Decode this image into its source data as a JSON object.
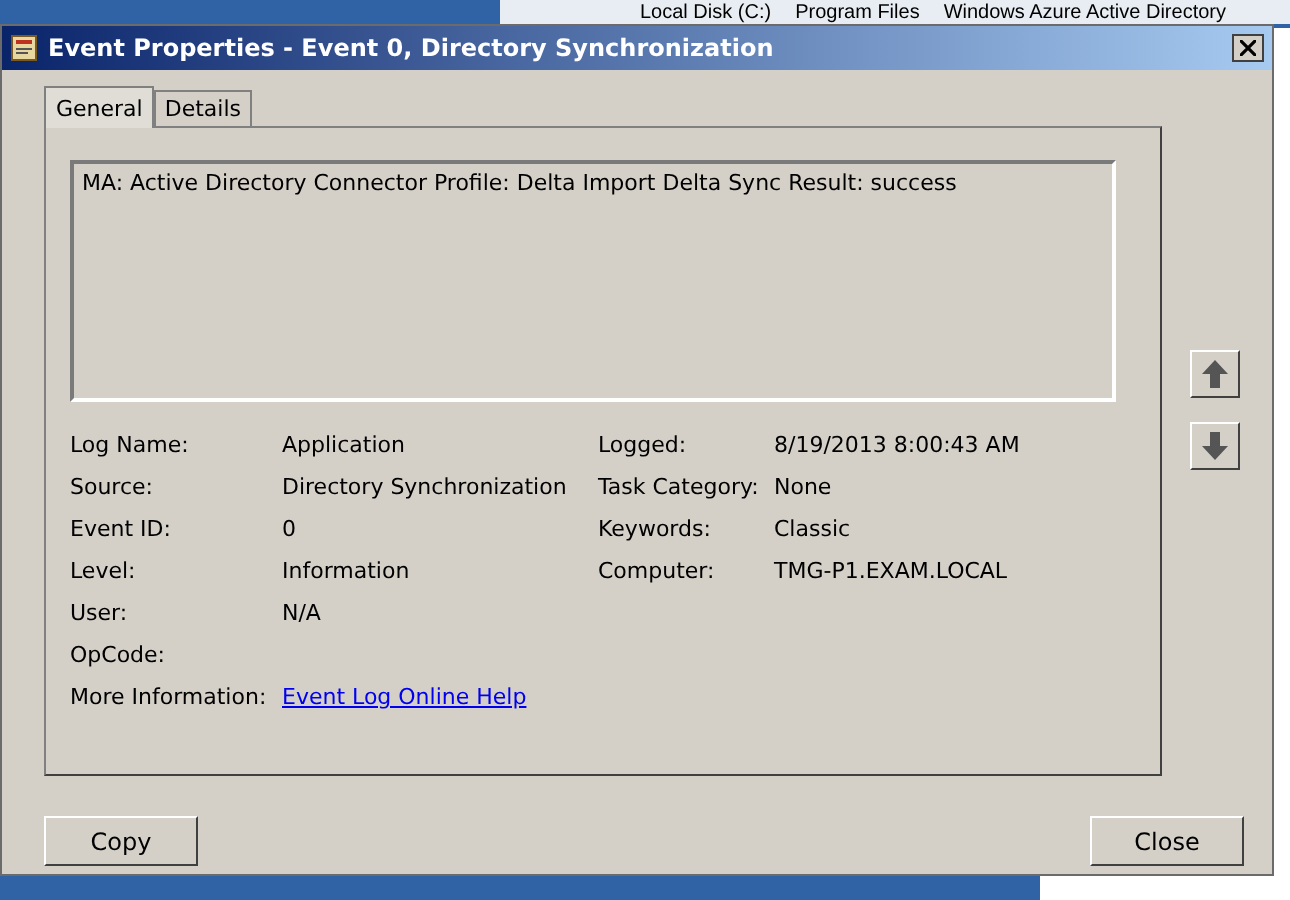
{
  "background": {
    "breadcrumb": [
      "Local Disk (C:)",
      "Program Files",
      "Windows Azure Active Directory"
    ]
  },
  "window": {
    "title": "Event Properties - Event 0, Directory Synchronization"
  },
  "tabs": [
    {
      "label": "General",
      "selected": true
    },
    {
      "label": "Details",
      "selected": false
    }
  ],
  "message": "MA: Active Directory Connector Profile: Delta Import Delta Sync Result: success",
  "fields_left": [
    {
      "label": "Log Name:",
      "value": "Application"
    },
    {
      "label": "Source:",
      "value": "Directory Synchronization"
    },
    {
      "label": "Event ID:",
      "value": "0"
    },
    {
      "label": "Level:",
      "value": "Information"
    },
    {
      "label": "User:",
      "value": "N/A"
    },
    {
      "label": "OpCode:"
    },
    {
      "label": "More Information:",
      "value": "Event Log Online Help",
      "kind": "link"
    }
  ],
  "fields_right": [
    {
      "label": "Logged:",
      "value": "8/19/2013 8:00:43 AM"
    },
    {
      "label": "Task Category:",
      "value": "None"
    },
    {
      "label": "Keywords:",
      "value": "Classic"
    },
    {
      "label": "Computer:",
      "value": "TMG-P1.EXAM.LOCAL"
    }
  ],
  "buttons": [
    "Copy",
    "Close"
  ]
}
